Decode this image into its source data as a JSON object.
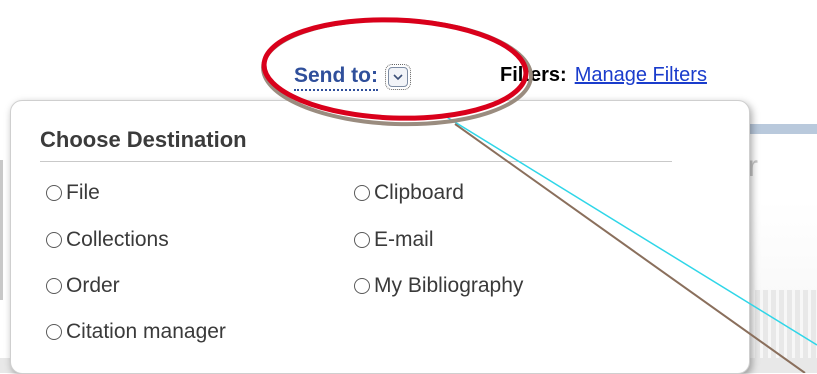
{
  "toolbar": {
    "send_to_label": "Send to:",
    "filters_label": "Filters:",
    "manage_filters_link": "Manage Filters"
  },
  "background": {
    "partial_letter": "r"
  },
  "popup": {
    "title": "Choose Destination",
    "options": [
      {
        "label": "File"
      },
      {
        "label": "Clipboard"
      },
      {
        "label": "Collections"
      },
      {
        "label": "E-mail"
      },
      {
        "label": "Order"
      },
      {
        "label": "My Bibliography"
      },
      {
        "label": "Citation manager"
      }
    ]
  },
  "colors": {
    "highlight_ellipse": "#d9001b",
    "link": "#1a3ccc",
    "send_to": "#2f4f9b"
  },
  "icons": {
    "dropdown": "chevron-down-icon",
    "radio": "radio-button-icon"
  }
}
